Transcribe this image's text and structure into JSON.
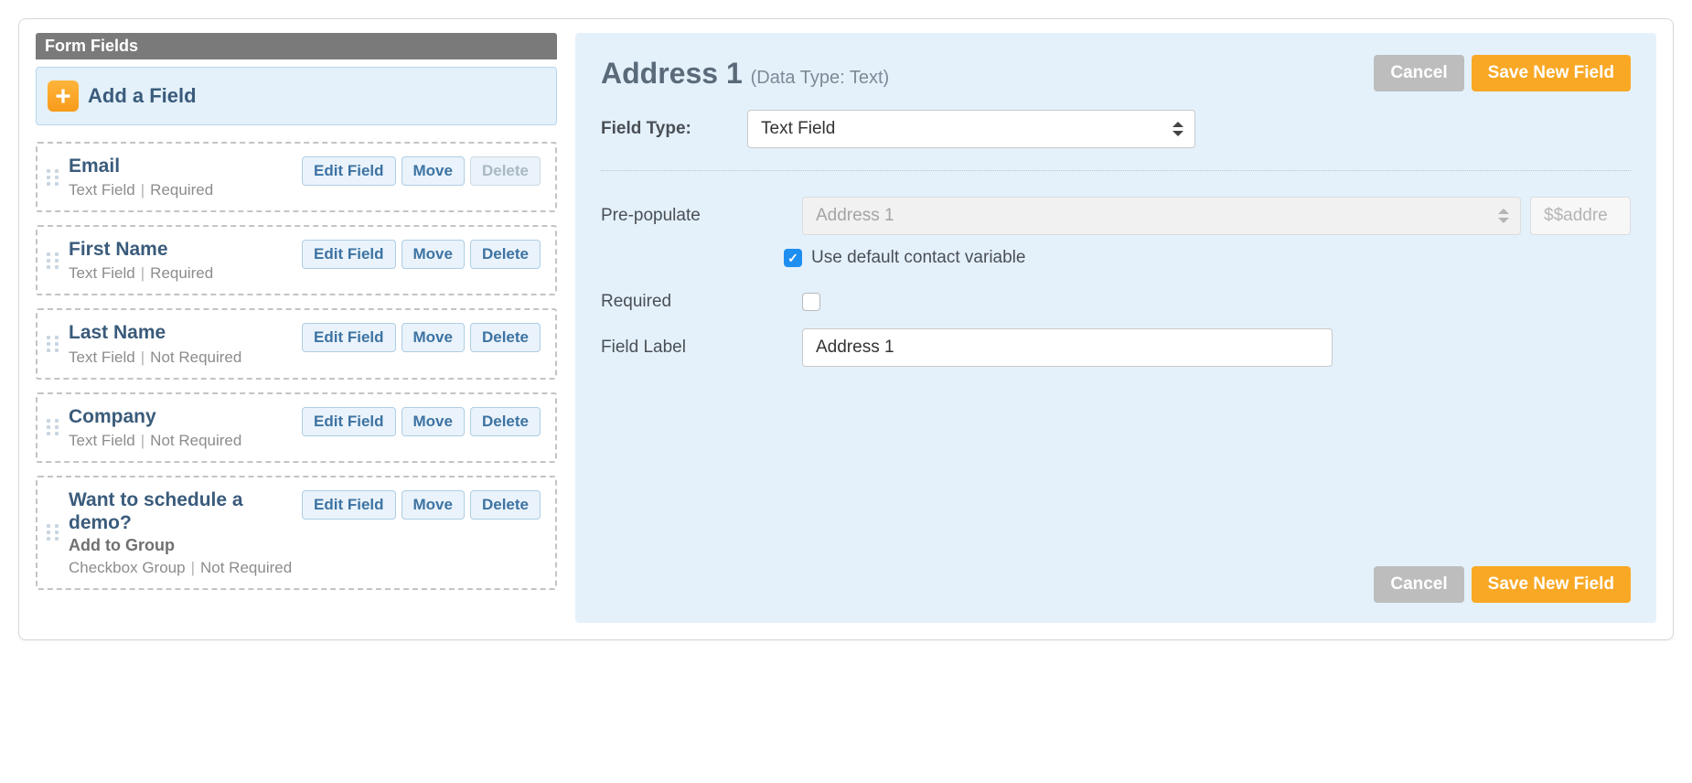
{
  "left": {
    "header": "Form Fields",
    "add_label": "Add a Field",
    "buttons": {
      "edit": "Edit Field",
      "move": "Move",
      "delete": "Delete"
    },
    "fields": [
      {
        "name": "Email",
        "subtitle": "",
        "type": "Text Field",
        "req": "Required",
        "delete_disabled": true
      },
      {
        "name": "First Name",
        "subtitle": "",
        "type": "Text Field",
        "req": "Required",
        "delete_disabled": false
      },
      {
        "name": "Last Name",
        "subtitle": "",
        "type": "Text Field",
        "req": "Not Required",
        "delete_disabled": false
      },
      {
        "name": "Company",
        "subtitle": "",
        "type": "Text Field",
        "req": "Not Required",
        "delete_disabled": false
      },
      {
        "name": "Want to schedule a demo?",
        "subtitle": "Add to Group",
        "type": "Checkbox Group",
        "req": "Not Required",
        "delete_disabled": false
      }
    ]
  },
  "right": {
    "title": "Address 1",
    "data_type_label": "(Data Type: Text)",
    "buttons": {
      "cancel": "Cancel",
      "save": "Save New Field"
    },
    "field_type_label": "Field Type:",
    "field_type_value": "Text Field",
    "prepopulate_label": "Pre-populate",
    "prepopulate_value": "Address 1",
    "prepopulate_var": "$$addre",
    "use_default_label": "Use default contact variable",
    "use_default_checked": true,
    "required_label": "Required",
    "required_checked": false,
    "field_label_label": "Field Label",
    "field_label_value": "Address 1"
  }
}
